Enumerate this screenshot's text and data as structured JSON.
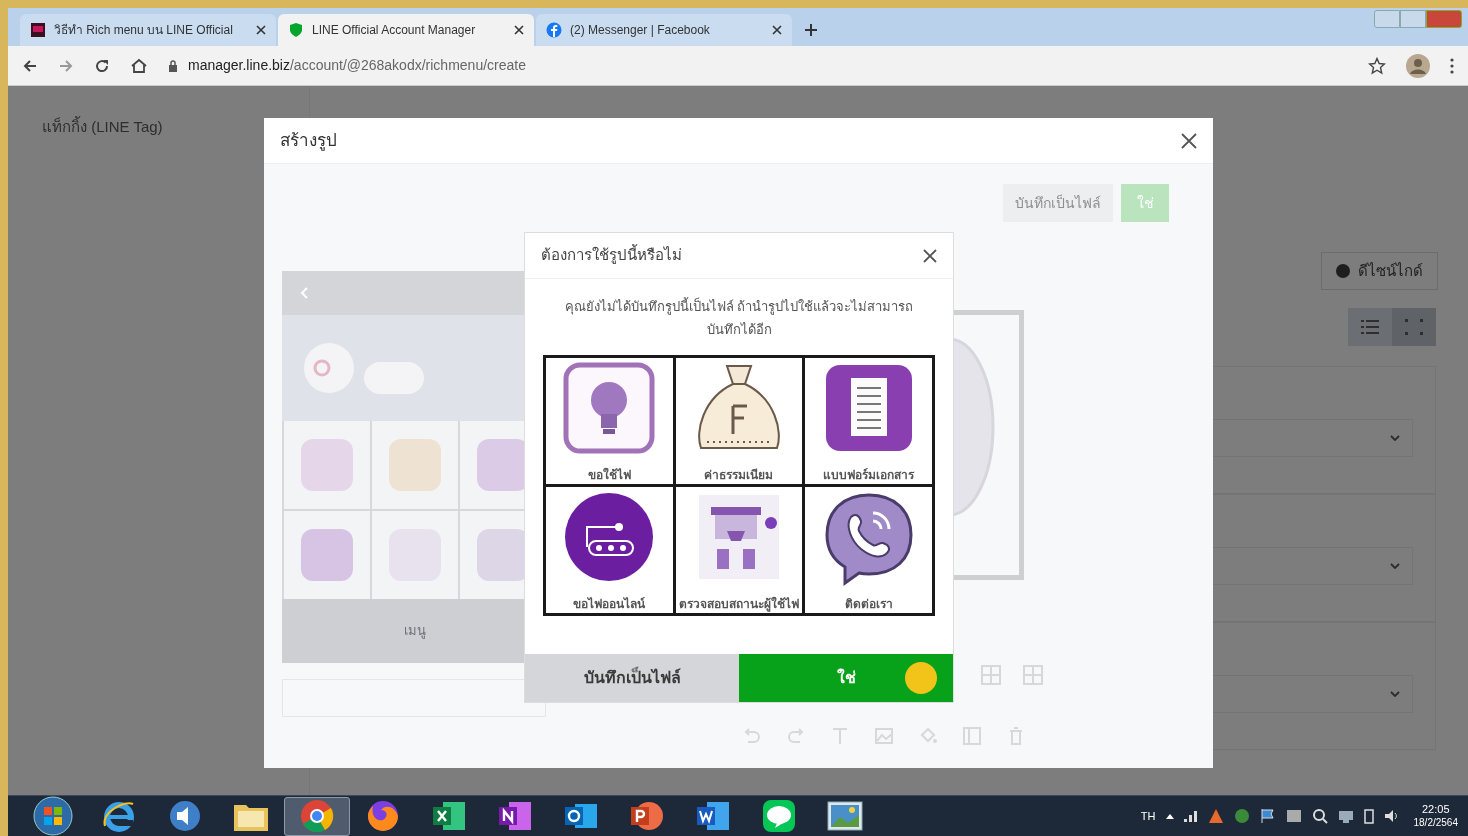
{
  "browser": {
    "tabs": [
      {
        "title": "วิธีทำ Rich menu บน LINE Official",
        "kind": "slides",
        "selected": false
      },
      {
        "title": "LINE Official Account Manager",
        "kind": "shield",
        "selected": true
      },
      {
        "title": "(2) Messenger | Facebook",
        "kind": "facebook",
        "selected": false
      }
    ],
    "url_host": "manager.line.biz",
    "url_path": "/account/@268akodx/richmenu/create"
  },
  "sidebar": {
    "items": [
      "แท็กกิ้ง (LINE Tag)"
    ]
  },
  "page": {
    "design_guide_button": "ดีไซน์ไกด์",
    "view_toggle": [
      {
        "kind": "list",
        "selected": false
      },
      {
        "kind": "grid",
        "selected": true
      }
    ]
  },
  "create_dialog": {
    "title": "สร้างรูป",
    "save_button": "บันทึกเป็นไฟล์",
    "apply_button": "ใช่",
    "menu_bar_label": "เมนู"
  },
  "confirm_dialog": {
    "title": "ต้องการใช้รูปนี้หรือไม่",
    "message": "คุณยังไม่ได้บันทึกรูปนี้เป็นไฟล์ ถ้านำรูปไปใช้แล้วจะไม่สามารถบันทึกได้อีก",
    "tiles": [
      {
        "kind": "bulb",
        "label": "ขอใช้ไฟ"
      },
      {
        "kind": "bag",
        "label": "ค่าธรรมเนียม"
      },
      {
        "kind": "document",
        "label": "แบบฟอร์มเอกสาร"
      },
      {
        "kind": "plug",
        "label": "ขอไฟออนไลน์"
      },
      {
        "kind": "status",
        "label": "ตรวจสอบสถานะผู้ใช้ไฟ"
      },
      {
        "kind": "phone",
        "label": "ติดต่อเรา"
      }
    ],
    "save_button": "บันทึกเป็นไฟล์",
    "confirm_button": "ใช่"
  },
  "taskbar": {
    "apps": [
      {
        "kind": "start",
        "selected": false
      },
      {
        "kind": "ie",
        "selected": false
      },
      {
        "kind": "media",
        "selected": false
      },
      {
        "kind": "folder",
        "selected": false
      },
      {
        "kind": "chrome",
        "selected": true
      },
      {
        "kind": "firefox",
        "selected": false
      },
      {
        "kind": "excel",
        "selected": false
      },
      {
        "kind": "onenote",
        "selected": false
      },
      {
        "kind": "outlook",
        "selected": false
      },
      {
        "kind": "powerpoint",
        "selected": false
      },
      {
        "kind": "word",
        "selected": false
      },
      {
        "kind": "line",
        "selected": false
      },
      {
        "kind": "photos",
        "selected": false
      }
    ],
    "language": "TH",
    "time": "22:05",
    "date": "18/2/2564"
  }
}
